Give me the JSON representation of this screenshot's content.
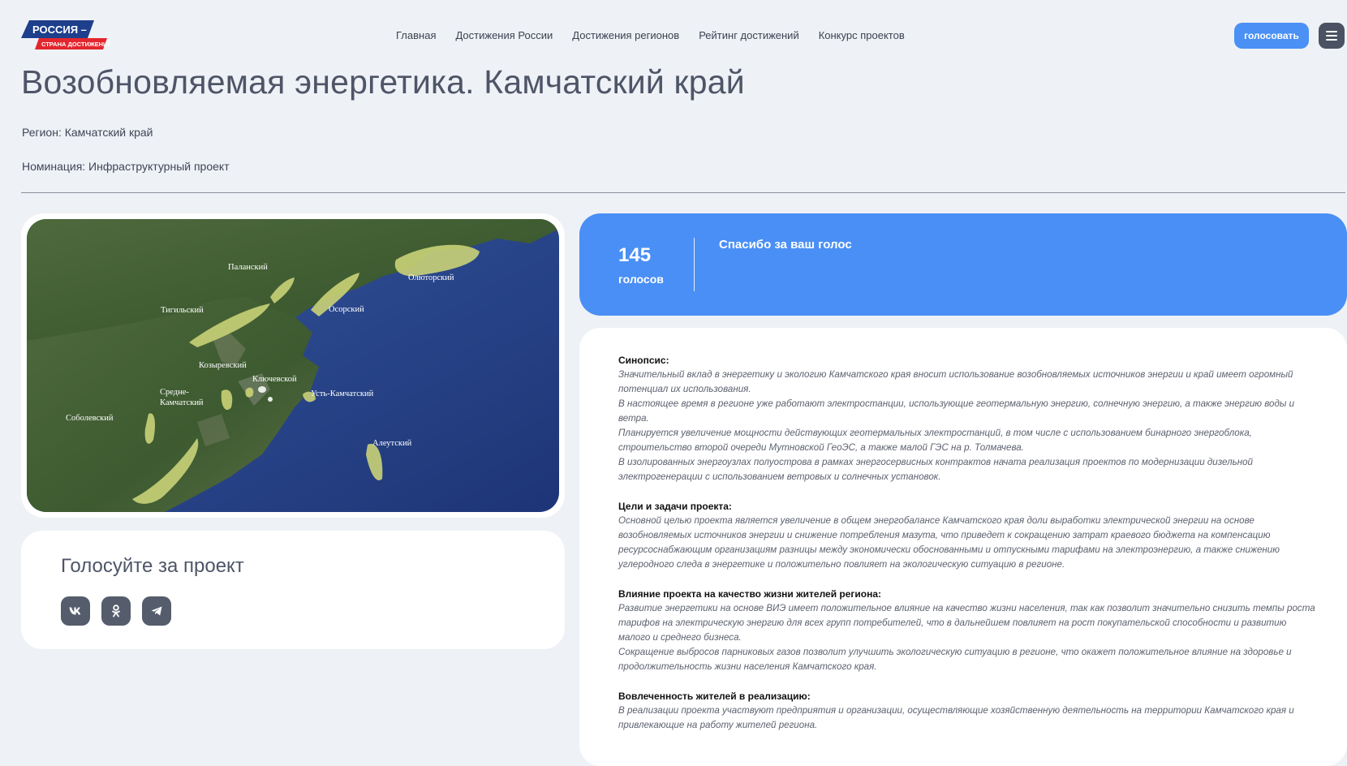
{
  "header": {
    "logo": {
      "line1": "РОССИЯ –",
      "line2": "СТРАНА ДОСТИЖЕНИЙ"
    },
    "nav": [
      "Главная",
      "Достижения России",
      "Достижения регионов",
      "Рейтинг достижений",
      "Конкурс проектов"
    ],
    "vote_button": "голосовать",
    "menu_icon": "hamburger-icon"
  },
  "page": {
    "title": "Возобновляемая энергетика. Камчатский край",
    "region": "Регион: Камчатский край",
    "nomination": "Номинация: Инфраструктурный проект"
  },
  "map": {
    "labels": [
      "Паланский",
      "Олюторский",
      "Тигильский",
      "Осорский",
      "Козыревский",
      "Ключевской",
      "Средне-",
      "Камчатский",
      "Усть-Камчатский",
      "Соболевский",
      "Алеутский"
    ],
    "colors": {
      "sea": "#243f85",
      "land": "#3f5a32",
      "zone": "#c9d277"
    }
  },
  "share": {
    "title": "Голосуйте за проект",
    "icons": [
      "vk-icon",
      "odnoklassniki-icon",
      "telegram-icon"
    ]
  },
  "votes": {
    "count": "145",
    "unit": "голосов",
    "message": "Спасибо за ваш голос"
  },
  "description": {
    "sections": [
      {
        "title": "Синопсис:",
        "text": "Значительный вклад в энергетику и экологию Камчатского края вносит использование возобновляемых источников энергии и край имеет огромный потенциал их использования.\nВ настоящее время в регионе уже работают электростанции, использующие геотермальную энергию, солнечную энергию, а также энергию воды и ветра.\nПланируется увеличение мощности действующих геотермальных электростанций, в том числе с использованием бинарного энергоблока, строительство второй очереди Мутновской ГеоЭС, а также малой ГЭС на р. Толмачева.\nВ изолированных энергоузлах полуострова в рамках энергосервисных контрактов начата реализация проектов по модернизации дизельной электрогенерации с использованием ветровых и солнечных установок."
      },
      {
        "title": "Цели и задачи проекта:",
        "text": "Основной целью проекта является увеличение в общем энергобалансе Камчатского края доли выработки электрической энергии на основе возобновляемых источников энергии и снижение потребления мазута, что приведет к сокращению затрат краевого бюджета на компенсацию ресурсоснабжающим организациям разницы между экономически обоснованными и отпускными тарифами на электроэнергию, а также снижению углеродного следа в энергетике и положительно повлияет на экологическую ситуацию в регионе."
      },
      {
        "title": "Влияние проекта на качество жизни жителей региона:",
        "text": "Развитие энергетики на основе ВИЭ имеет положительное влияние на качество жизни населения, так как позволит значительно снизить темпы роста тарифов на электрическую энергию для всех групп потребителей, что в дальнейшем повлияет на рост покупательской способности и развитию малого и среднего бизнеса.\nСокращение выбросов парниковых газов позволит улучшить экологическую ситуацию в регионе, что окажет положительное влияние на здоровье и продолжительность жизни населения Камчатского края."
      },
      {
        "title": "Вовлеченность жителей в реализацию:",
        "text": "В реализации проекта участвуют предприятия и организации, осуществляющие хозяйственную деятельность на территории Камчатского края и привлекающие на работу жителей региона."
      }
    ]
  },
  "theme": {
    "accent": "#4a8ff5",
    "background": "#eef1f6",
    "dark_button": "#555d6c"
  }
}
